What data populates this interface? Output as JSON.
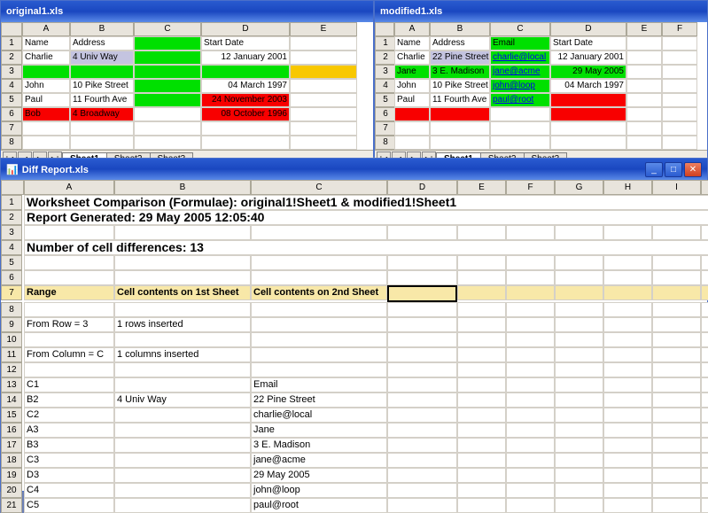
{
  "win1": {
    "title": "original1.xls",
    "cols": [
      "",
      "A",
      "B",
      "C",
      "D",
      "E"
    ],
    "rows": [
      {
        "n": "1",
        "cells": [
          {
            "v": "Name"
          },
          {
            "v": "Address"
          },
          {
            "v": "",
            "cls": "green"
          },
          {
            "v": "Start Date"
          },
          {
            "v": ""
          }
        ]
      },
      {
        "n": "2",
        "cells": [
          {
            "v": "Charlie"
          },
          {
            "v": "4 Univ Way",
            "cls": "sel"
          },
          {
            "v": "",
            "cls": "green"
          },
          {
            "v": "12 January 2001",
            "align": "right"
          },
          {
            "v": ""
          }
        ]
      },
      {
        "n": "3",
        "cells": [
          {
            "v": "",
            "cls": "green"
          },
          {
            "v": "",
            "cls": "green"
          },
          {
            "v": "",
            "cls": "green"
          },
          {
            "v": "",
            "cls": "green"
          },
          {
            "v": "",
            "cls": "gold"
          }
        ]
      },
      {
        "n": "4",
        "cells": [
          {
            "v": "John"
          },
          {
            "v": "10 Pike Street"
          },
          {
            "v": "",
            "cls": "green"
          },
          {
            "v": "04 March 1997",
            "align": "right"
          },
          {
            "v": ""
          }
        ]
      },
      {
        "n": "5",
        "cells": [
          {
            "v": "Paul"
          },
          {
            "v": "11 Fourth Ave"
          },
          {
            "v": "",
            "cls": "green"
          },
          {
            "v": "24 November 2003",
            "cls": "red",
            "align": "right"
          },
          {
            "v": ""
          }
        ]
      },
      {
        "n": "6",
        "cells": [
          {
            "v": "Bob",
            "cls": "red"
          },
          {
            "v": "4 Broadway",
            "cls": "red"
          },
          {
            "v": ""
          },
          {
            "v": "08 October 1996",
            "cls": "red",
            "align": "right"
          },
          {
            "v": ""
          }
        ]
      },
      {
        "n": "7",
        "cells": [
          {
            "v": ""
          },
          {
            "v": ""
          },
          {
            "v": ""
          },
          {
            "v": ""
          },
          {
            "v": ""
          }
        ]
      },
      {
        "n": "8",
        "cells": [
          {
            "v": ""
          },
          {
            "v": ""
          },
          {
            "v": ""
          },
          {
            "v": ""
          },
          {
            "v": ""
          }
        ]
      }
    ],
    "tabs": [
      "Sheet1",
      "Sheet2",
      "Sheet3"
    ]
  },
  "win2": {
    "title": "modified1.xls",
    "cols": [
      "",
      "A",
      "B",
      "C",
      "D",
      "E",
      "F"
    ],
    "rows": [
      {
        "n": "1",
        "cells": [
          {
            "v": "Name"
          },
          {
            "v": "Address"
          },
          {
            "v": "Email",
            "cls": "green"
          },
          {
            "v": "Start Date"
          },
          {
            "v": ""
          },
          {
            "v": ""
          }
        ]
      },
      {
        "n": "2",
        "cells": [
          {
            "v": "Charlie"
          },
          {
            "v": "22 Pine Street",
            "cls": "sel"
          },
          {
            "v": "charlie@local",
            "cls": "green link"
          },
          {
            "v": "12 January 2001",
            "align": "right"
          },
          {
            "v": ""
          },
          {
            "v": ""
          }
        ]
      },
      {
        "n": "3",
        "cells": [
          {
            "v": "Jane",
            "cls": "green"
          },
          {
            "v": "3 E. Madison",
            "cls": "green"
          },
          {
            "v": "jane@acme",
            "cls": "green link"
          },
          {
            "v": "29 May 2005",
            "cls": "green",
            "align": "right"
          },
          {
            "v": ""
          },
          {
            "v": ""
          }
        ]
      },
      {
        "n": "4",
        "cells": [
          {
            "v": "John"
          },
          {
            "v": "10 Pike Street"
          },
          {
            "v": "john@loop",
            "cls": "green link"
          },
          {
            "v": "04 March 1997",
            "align": "right"
          },
          {
            "v": ""
          },
          {
            "v": ""
          }
        ]
      },
      {
        "n": "5",
        "cells": [
          {
            "v": "Paul"
          },
          {
            "v": "11 Fourth Ave"
          },
          {
            "v": "paul@root",
            "cls": "green link"
          },
          {
            "v": "",
            "cls": "red"
          },
          {
            "v": ""
          },
          {
            "v": ""
          }
        ]
      },
      {
        "n": "6",
        "cells": [
          {
            "v": "",
            "cls": "red"
          },
          {
            "v": "",
            "cls": "red"
          },
          {
            "v": ""
          },
          {
            "v": "",
            "cls": "red"
          },
          {
            "v": ""
          },
          {
            "v": ""
          }
        ]
      },
      {
        "n": "7",
        "cells": [
          {
            "v": ""
          },
          {
            "v": ""
          },
          {
            "v": ""
          },
          {
            "v": ""
          },
          {
            "v": ""
          },
          {
            "v": ""
          }
        ]
      },
      {
        "n": "8",
        "cells": [
          {
            "v": ""
          },
          {
            "v": ""
          },
          {
            "v": ""
          },
          {
            "v": ""
          },
          {
            "v": ""
          },
          {
            "v": ""
          }
        ]
      }
    ],
    "tabs": [
      "Sheet1",
      "Sheet2",
      "Sheet3"
    ]
  },
  "diff": {
    "title": "Diff Report.xls",
    "cols": [
      "",
      "A",
      "B",
      "C",
      "D",
      "E",
      "F",
      "G",
      "H",
      "I",
      "J"
    ],
    "title_row": "Worksheet Comparison (Formulae): original1!Sheet1 & modified1!Sheet1",
    "gen_row": "Report Generated: 29 May 2005 12:05:40",
    "count_row": "Number of cell differences: 13",
    "hdr": {
      "a": "Range",
      "b": "Cell contents on 1st Sheet",
      "c": "Cell contents on 2nd Sheet"
    },
    "rows": [
      {
        "n": "9",
        "a": "From Row = 3",
        "b": "1 rows inserted",
        "c": ""
      },
      {
        "n": "10",
        "a": "",
        "b": "",
        "c": ""
      },
      {
        "n": "11",
        "a": "From Column = C",
        "b": "1 columns inserted",
        "c": ""
      },
      {
        "n": "12",
        "a": "",
        "b": "",
        "c": ""
      },
      {
        "n": "13",
        "a": "C1",
        "b": "",
        "c": "Email"
      },
      {
        "n": "14",
        "a": "B2",
        "b": "4 Univ Way",
        "c": "22 Pine Street"
      },
      {
        "n": "15",
        "a": "C2",
        "b": "",
        "c": "charlie@local"
      },
      {
        "n": "16",
        "a": "A3",
        "b": "",
        "c": "Jane"
      },
      {
        "n": "17",
        "a": "B3",
        "b": "",
        "c": "3 E. Madison"
      },
      {
        "n": "18",
        "a": "C3",
        "b": "",
        "c": "jane@acme"
      },
      {
        "n": "19",
        "a": "D3",
        "b": "",
        "c": "29 May 2005"
      },
      {
        "n": "20",
        "a": "C4",
        "b": "",
        "c": "john@loop"
      },
      {
        "n": "21",
        "a": "C5",
        "b": "",
        "c": "paul@root"
      }
    ]
  },
  "nav": {
    "first": "|◀",
    "prev": "◀",
    "next": "▶",
    "last": "▶|"
  },
  "wctrl": {
    "min": "_",
    "max": "□",
    "close": "✕"
  }
}
